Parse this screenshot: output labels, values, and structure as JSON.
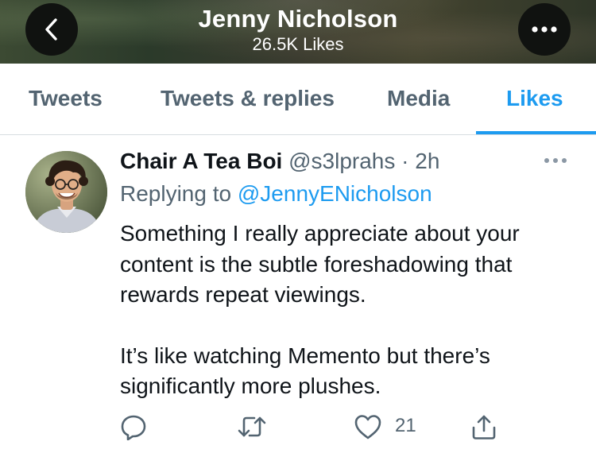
{
  "header": {
    "title": "Jenny Nicholson",
    "subtitle": "26.5K Likes"
  },
  "tabs": [
    {
      "label": "Tweets",
      "active": false
    },
    {
      "label": "Tweets & replies",
      "active": false
    },
    {
      "label": "Media",
      "active": false
    },
    {
      "label": "Likes",
      "active": true
    }
  ],
  "tweet": {
    "author_name": "Chair A Tea Boi",
    "handle": "@s3lprahs",
    "separator": "·",
    "time": "2h",
    "replying_prefix": "Replying to",
    "replying_to": "@JennyENicholson",
    "body": [
      "Something I really appreciate about your content is the subtle foreshadowing that rewards repeat viewings.",
      "It’s like watching Memento but there’s significantly more plushes."
    ],
    "like_count": "21"
  },
  "colors": {
    "accent": "#1d9bf0",
    "muted_text": "#536471",
    "primary_text": "#0f1419"
  },
  "icons": [
    "back-arrow-icon",
    "more-options-icon",
    "more-dots-icon",
    "reply-icon",
    "retweet-icon",
    "like-icon",
    "share-icon"
  ]
}
